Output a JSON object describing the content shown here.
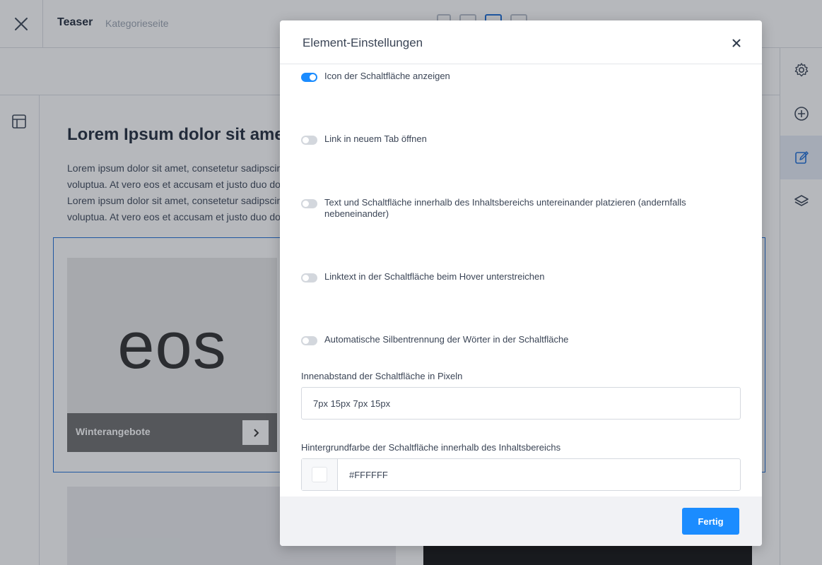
{
  "colors": {
    "accent": "#1b8cff",
    "selection": "#1b6dd6",
    "toggle_off": "#d3d7dd"
  },
  "topbar": {
    "close_icon": "close-icon",
    "title": "Teaser",
    "subtitle": "Kategorieseite",
    "viewports": [
      "mobile-icon",
      "tablet-icon",
      "desktop-icon",
      "desktop-wide-icon"
    ]
  },
  "left_rail": {
    "icon": "layout-icon"
  },
  "right_rail": {
    "items": [
      "settings-icon",
      "add-circle-icon",
      "edit-icon",
      "layers-icon"
    ],
    "active_index": 2
  },
  "canvas": {
    "heading": "Lorem Ipsum dolor sit amet",
    "paragraph_lines": [
      "Lorem ipsum dolor sit amet, consetetur sadipscing elitr",
      "voluptua. At vero eos et accusam et justo duo dolores",
      "Lorem ipsum dolor sit amet, consetetur sadipscing elitr",
      "voluptua. At vero eos et accusam et justo duo dolores"
    ],
    "teaser": {
      "image_word": "eos",
      "caption": "Winterangebote",
      "button_icon": "chevron-right-icon"
    }
  },
  "modal": {
    "title": "Element-Einstellungen",
    "close_icon": "close-icon",
    "toggles": [
      {
        "label": "Icon der Schaltfläche anzeigen",
        "on": true
      },
      {
        "label": "Link in neuem Tab öffnen",
        "on": false
      },
      {
        "label": "Text und Schaltfläche innerhalb des Inhaltsbereichs untereinander platzieren (andernfalls nebeneinander)",
        "on": false
      },
      {
        "label": "Linktext in der Schaltfläche beim Hover unterstreichen",
        "on": false
      },
      {
        "label": "Automatische Silbentrennung der Wörter in der Schaltfläche",
        "on": false
      }
    ],
    "padding_field": {
      "label": "Innenabstand der Schaltfläche in Pixeln",
      "value": "7px 15px 7px 15px"
    },
    "background_field": {
      "label": "Hintergrundfarbe der Schaltfläche innerhalb des Inhaltsbereichs",
      "value": "#FFFFFF",
      "swatch_color": "#FFFFFF"
    },
    "done_label": "Fertig"
  }
}
